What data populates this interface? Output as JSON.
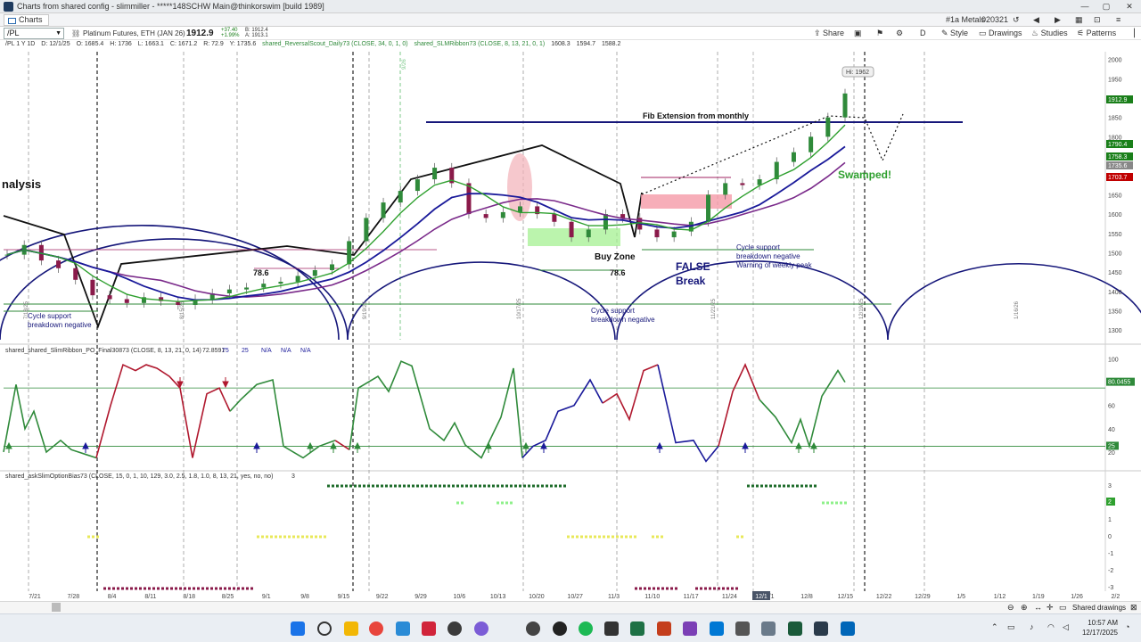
{
  "window": {
    "title": "Charts from shared config - slimmiller - *****148SCHW Main@thinkorswim [build 1989]",
    "watchlist": "#1a Metals",
    "account": "020321"
  },
  "tab": {
    "label": "Charts"
  },
  "toolbar": {
    "symbol": "/PL",
    "description": "Platinum Futures, ETH (JAN 26)",
    "last": "1912.9",
    "change": "+37.40",
    "change_pct": "+1.99%",
    "bid": "B: 1912.4",
    "ask": "A: 1913.1",
    "share": "Share",
    "style": "Style",
    "drawings": "Drawings",
    "studies": "Studies",
    "patterns": "Patterns",
    "interval_letter": "D"
  },
  "infobar": {
    "timeframe": "/PL 1 Y 1D",
    "date": "D: 12/1/25",
    "open": "O: 1685.4",
    "high": "H: 1736",
    "low": "L: 1663.1",
    "close": "C: 1671.2",
    "range": "R: 72.9",
    "yvalue": "Y: 1735.6",
    "study1": "shared_ReversalScout_Daily73 (CLOSE, 34, 0, 1, 0)",
    "study2": "shared_SLMRibbon73 (CLOSE, 8, 13, 21, 0, 1)",
    "study2_v1": "1608.3",
    "study2_v2": "1594.7",
    "study2_v3": "1588.2"
  },
  "chart_data": [
    {
      "type": "candlestick",
      "title": "",
      "ylim": [
        1275,
        2020
      ],
      "y_ticks": [
        2000,
        1950,
        1900,
        1850,
        1800,
        1750,
        1700,
        1650,
        1600,
        1550,
        1500,
        1450,
        1400,
        1350,
        1300
      ],
      "x_ticks": [
        "7/21",
        "7/28",
        "8/4",
        "8/11",
        "8/18",
        "8/25",
        "9/1",
        "9/8",
        "9/15",
        "9/22",
        "9/29",
        "10/6",
        "10/13",
        "10/20",
        "10/27",
        "11/3",
        "11/10",
        "11/17",
        "11/24",
        "12/1",
        "12/8",
        "12/15",
        "12/22",
        "12/29",
        "1/5",
        "1/12",
        "1/19",
        "1/26",
        "2/2"
      ],
      "price_labels": [
        {
          "value": "1912.9",
          "color": "#1a7f1a"
        },
        {
          "value": "1790.4",
          "color": "#1a7f1a"
        },
        {
          "value": "1758.3",
          "color": "#1a7f1a"
        },
        {
          "value": "1735.6",
          "color": "#888888"
        },
        {
          "value": "1703.7",
          "color": "#c00000"
        }
      ],
      "vertical_date_labels": [
        "7/18/25",
        "8/15/25",
        "9/19/25",
        "10/17/25",
        "11/21/25",
        "12/19/25",
        "1/16/26",
        "9/26"
      ],
      "annotations": {
        "analysis": "nalysis",
        "fib": "Fib Extension from monthly",
        "hi": "Hi: 1962",
        "swamped": "Swamped!",
        "buy_zone": "Buy Zone",
        "fib_786_a": "78.6",
        "fib_786_b": "78.6",
        "false_break_1": "FALSE",
        "false_break_2": "Break",
        "cycle_left_1": "Cycle support",
        "cycle_left_2": "breakdown negative",
        "cycle_mid_1": "Cycle support",
        "cycle_mid_2": "breakdown negative",
        "cycle_right_1": "Cycle support",
        "cycle_right_2": "breakdown negative",
        "cycle_right_3": "Warning of weekly peak"
      },
      "close_series": [
        1495,
        1520,
        1480,
        1460,
        1430,
        1390,
        1380,
        1370,
        1385,
        1375,
        1365,
        1380,
        1395,
        1405,
        1410,
        1420,
        1425,
        1440,
        1455,
        1470,
        1530,
        1590,
        1630,
        1660,
        1690,
        1720,
        1680,
        1600,
        1590,
        1605,
        1620,
        1600,
        1580,
        1540,
        1560,
        1600,
        1590,
        1560,
        1540,
        1555,
        1580,
        1650,
        1680,
        1675,
        1690,
        1735,
        1760,
        1800,
        1850,
        1912
      ]
    },
    {
      "type": "line",
      "title": "shared_shared_SlimRibbon_PO_Final30873 (CLOSE, 8, 13, 21, 0, 14)",
      "header_values": [
        "72.8591",
        "75",
        "25",
        "N/A",
        "N/A",
        "N/A"
      ],
      "ylim": [
        10,
        105
      ],
      "y_ticks": [
        "100",
        "80",
        "60",
        "40",
        "20"
      ],
      "last_label": "80.0455",
      "level_label": "25",
      "levels": [
        75,
        25
      ]
    },
    {
      "type": "scatter",
      "title": "shared_askSlimOptionBias73 (CLOSE, 15, 0, 1, 10, 129, 3.0, 2.5, 1.8, 1.0, 8, 13, 21, yes, no, no)",
      "header_value": "3",
      "y_ticks": [
        "3",
        "2",
        "1",
        "0",
        "-1",
        "-2",
        "-3"
      ],
      "current_label": "2"
    }
  ],
  "statusbar": {
    "shared_drawings": "Shared drawings",
    "current_date": "12/1"
  },
  "taskbar": {
    "time": "10:57 AM",
    "date": "12/17/2025"
  }
}
